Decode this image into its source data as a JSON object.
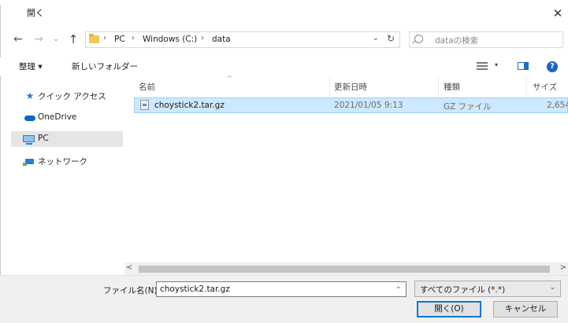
{
  "window": {
    "title": "開く",
    "close_glyph": "✕"
  },
  "nav": {
    "back_glyph": "←",
    "forward_glyph": "→",
    "recent_glyph": "⌄",
    "up_glyph": "↑"
  },
  "address": {
    "breadcrumbs": [
      "PC",
      "Windows (C:)",
      "data"
    ],
    "separator": "›",
    "dropdown_glyph": "⌄",
    "refresh_glyph": "↻"
  },
  "search": {
    "placeholder": "dataの検索"
  },
  "toolbar": {
    "organize_label": "整理 ▾",
    "new_folder_label": "新しいフォルダー",
    "view_arrow": "▾",
    "help_glyph": "?"
  },
  "sidebar": {
    "items": [
      {
        "label": "クイック アクセス",
        "icon": "star-icon",
        "selected": false
      },
      {
        "label": "OneDrive",
        "icon": "cloud-icon",
        "selected": false
      },
      {
        "label": "PC",
        "icon": "computer-icon",
        "selected": true
      },
      {
        "label": "ネットワーク",
        "icon": "network-icon",
        "selected": false
      }
    ]
  },
  "file_list": {
    "sort_glyph": "^",
    "columns": [
      "名前",
      "更新日時",
      "種類",
      "サイズ"
    ],
    "rows": [
      {
        "name": "choystick2.tar.gz",
        "modified": "2021/01/05 9:13",
        "type": "GZ ファイル",
        "size": "2,654",
        "selected": true
      }
    ]
  },
  "scrollbar": {
    "left_glyph": "<",
    "right_glyph": ">"
  },
  "footer": {
    "filename_label": "ファイル名(N):",
    "filename_value": "choystick2.tar.gz",
    "filename_dropdown_glyph": "⌄",
    "filetype_value": "すべてのファイル (*.*)",
    "filetype_arrow": "⌄",
    "open_label": "開く(O)",
    "cancel_label": "キャンセル"
  },
  "colors": {
    "selection_bg": "#cde8ff",
    "selection_border": "#99d1ff",
    "accent": "#0078d7"
  }
}
